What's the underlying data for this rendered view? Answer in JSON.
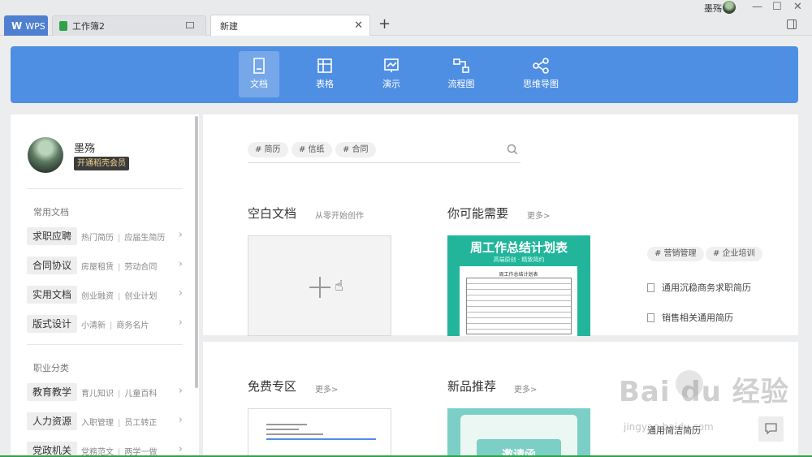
{
  "titlebar": {
    "tabs": [
      {
        "label": "WPS",
        "glyph": "W"
      },
      {
        "label": "工作簿2"
      },
      {
        "label": "新建"
      }
    ],
    "user_name": "墨殇",
    "window_controls": [
      "minimize",
      "maximize",
      "close"
    ]
  },
  "categories": [
    {
      "label": "文档",
      "icon": "document-icon",
      "active": true
    },
    {
      "label": "表格",
      "icon": "table-icon"
    },
    {
      "label": "演示",
      "icon": "presentation-icon"
    },
    {
      "label": "流程图",
      "icon": "flowchart-icon"
    },
    {
      "label": "思维导图",
      "icon": "mindmap-icon"
    }
  ],
  "profile": {
    "name": "墨殇",
    "vip_button": "开通稻壳会员"
  },
  "sidebar": {
    "section1_title": "常用文档",
    "section1_rows": [
      {
        "category": "求职应聘",
        "links": [
          "热门简历",
          "应届生简历"
        ]
      },
      {
        "category": "合同协议",
        "links": [
          "房屋租赁",
          "劳动合同"
        ]
      },
      {
        "category": "实用文档",
        "links": [
          "创业融资",
          "创业计划"
        ]
      },
      {
        "category": "版式设计",
        "links": [
          "小清新",
          "商务名片"
        ]
      }
    ],
    "section2_title": "职业分类",
    "section2_rows": [
      {
        "category": "教育教学",
        "links": [
          "育儿知识",
          "儿童百科"
        ]
      },
      {
        "category": "人力资源",
        "links": [
          "入职管理",
          "员工转正"
        ]
      },
      {
        "category": "党政机关",
        "links": [
          "党務范文",
          "两学一做"
        ]
      }
    ]
  },
  "search": {
    "tags": [
      "# 简历",
      "# 信纸",
      "# 合同"
    ]
  },
  "blank_doc": {
    "title": "空白文档",
    "subtitle": "从零开始创作"
  },
  "recommend": {
    "title": "你可能需要",
    "more": "更多>",
    "template_title": "周工作总结计划表",
    "template_subtitle": "高端原创 · 精致简约",
    "template_inner_title": "周工作总结计划表",
    "tags": [
      "# 营销管理",
      "# 企业培训"
    ],
    "doc_links": [
      "通用沉稳商务求职简历",
      "销售相关通用简历"
    ]
  },
  "free_zone": {
    "title": "免费专区",
    "more": "更多>"
  },
  "new_products": {
    "title": "新品推荐",
    "more": "更多>",
    "card_text": "邀请函",
    "side_link": "通用简洁简历"
  },
  "watermark": {
    "brand": "Bai du 经验",
    "url": "jingyan.baidu.com"
  }
}
